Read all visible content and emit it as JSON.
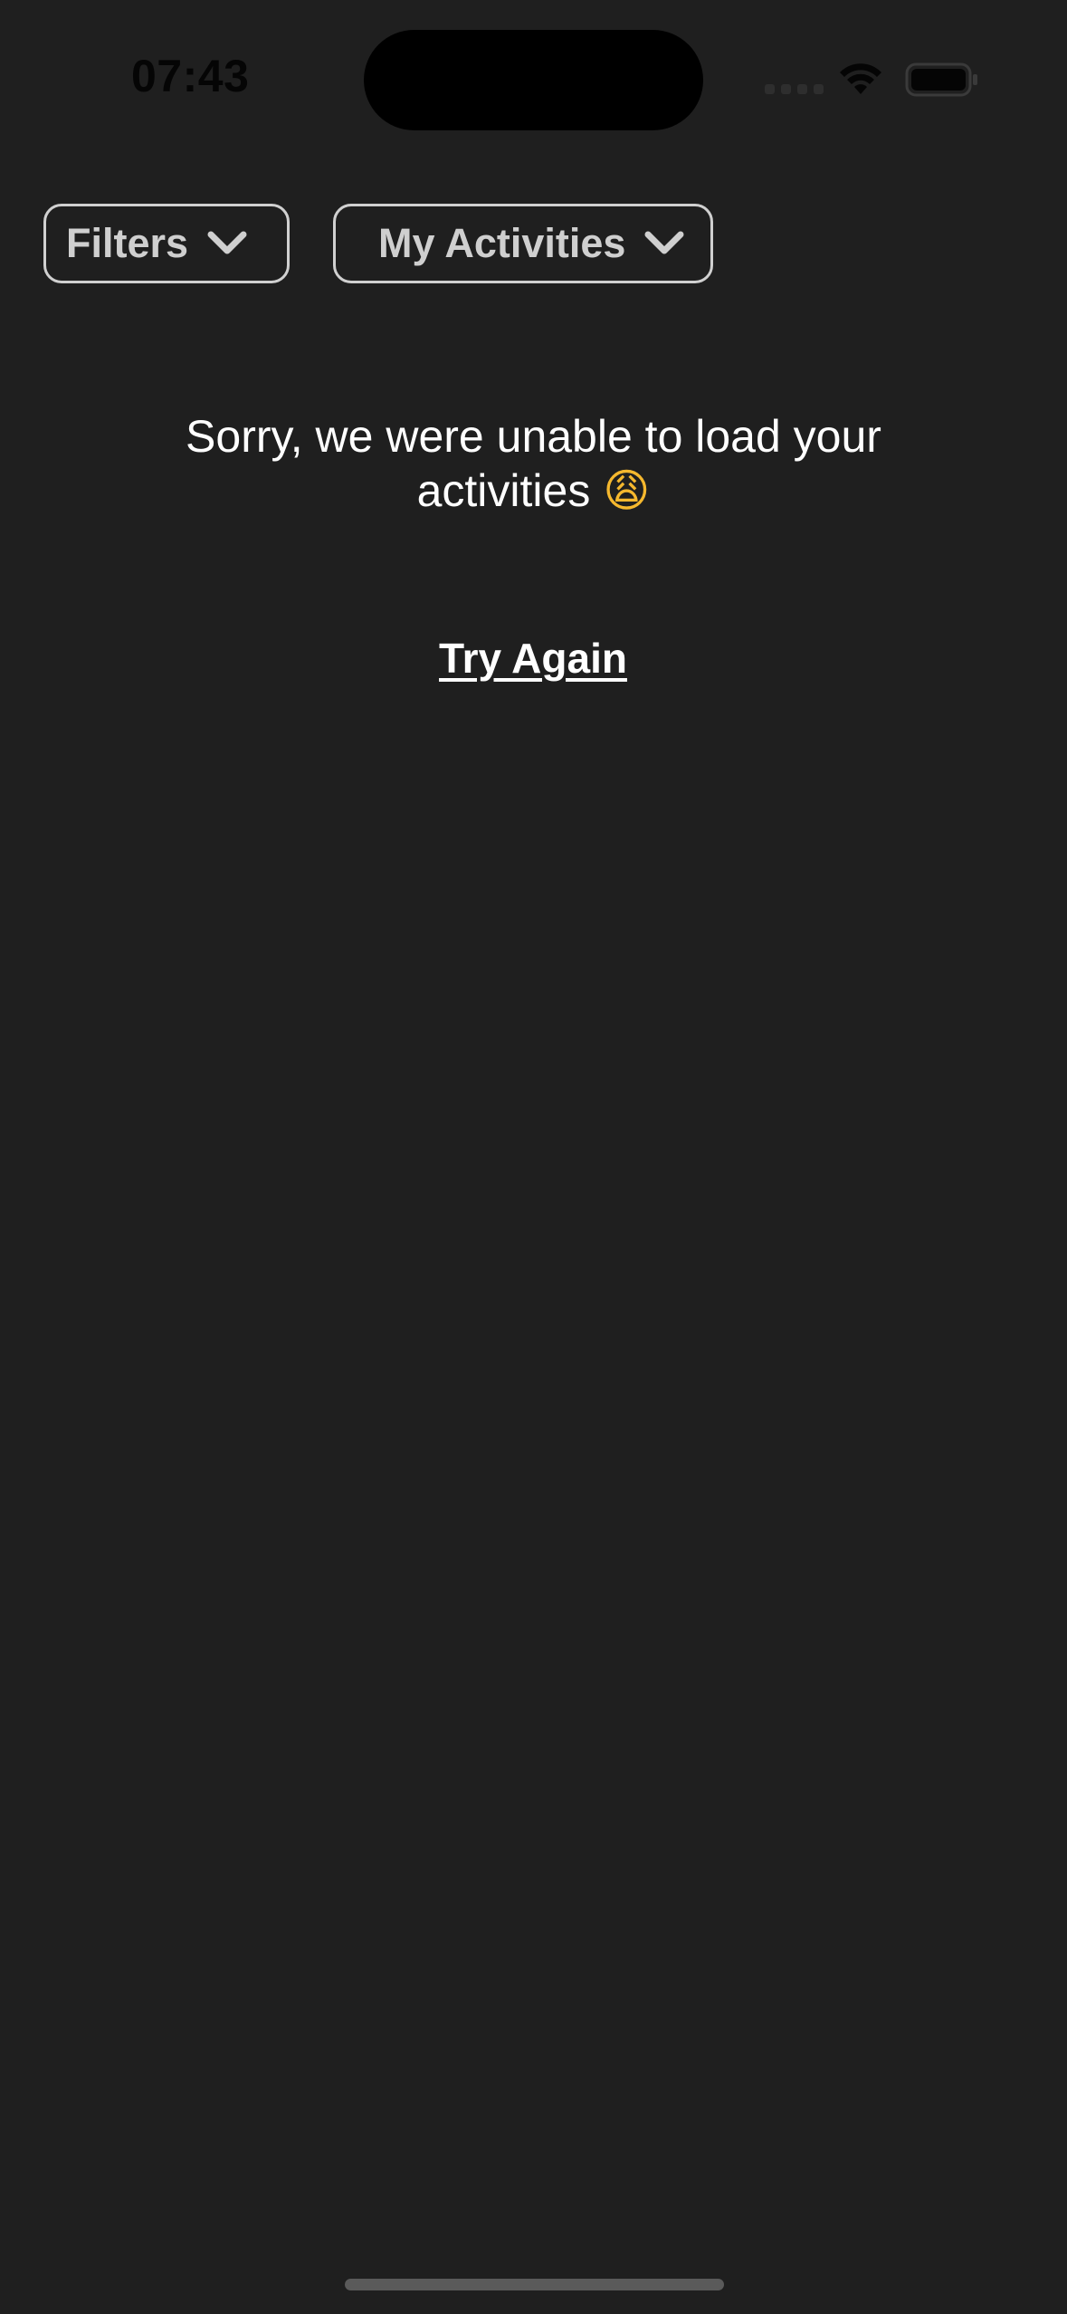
{
  "status_bar": {
    "time": "07:43",
    "wifi_icon": "wifi-icon",
    "battery_icon": "battery-icon",
    "signal_icon": "cellular-signal-icon"
  },
  "filters": {
    "filters_label": "Filters",
    "activities_label": "My Activities",
    "chevron_icon": "chevron-down-icon"
  },
  "error": {
    "message": "Sorry, we were unable to load your activities",
    "emoji": "😩",
    "retry_label": "Try Again"
  },
  "colors": {
    "background": "#1f1f1f",
    "text": "#ffffff",
    "pill_border": "#d0d0d0",
    "pill_text": "#cfcfcf"
  }
}
